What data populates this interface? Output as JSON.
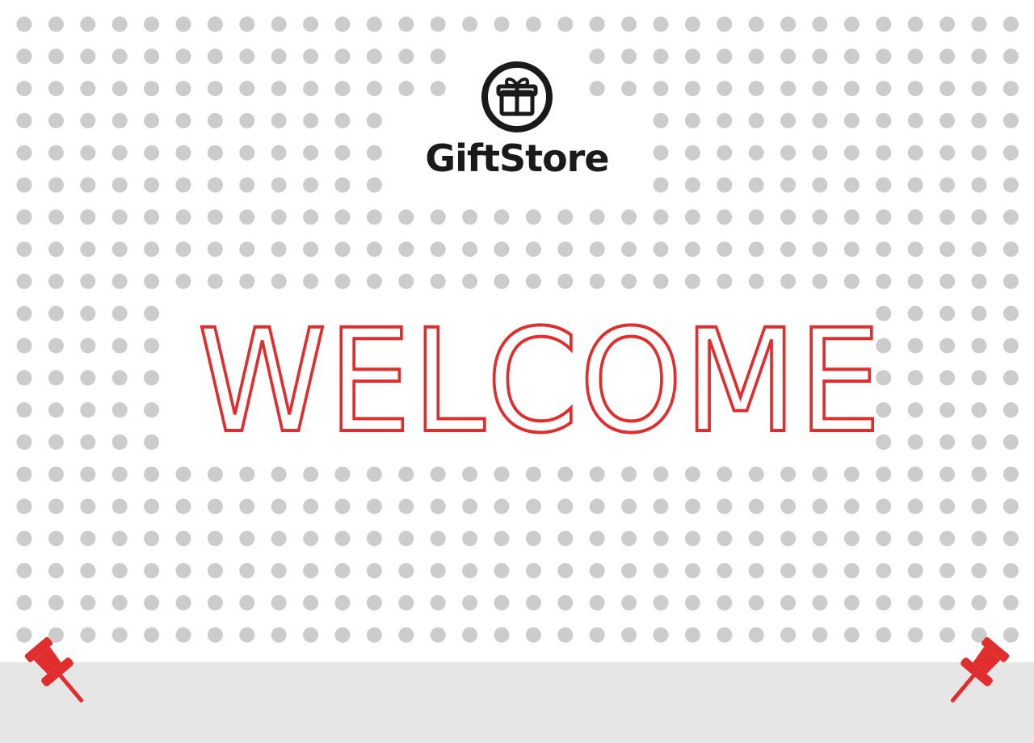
{
  "brand": {
    "name": "GiftStore",
    "logo_icon": "gift-icon"
  },
  "headline": "WELCOME",
  "decorations": {
    "pin_icon": "pushpin-icon",
    "pin_color": "#e02d2d"
  },
  "colors": {
    "accent": "#e02d2d",
    "dot": "#cccccc",
    "background": "#ffffff",
    "floor": "#e6e6e6",
    "logo": "#1a1a1a"
  }
}
